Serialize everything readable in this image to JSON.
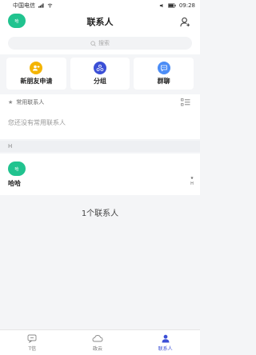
{
  "status_bar": {
    "carrier": "中国电信",
    "time": "09:28"
  },
  "header": {
    "avatar_text": "哈",
    "title": "联系人"
  },
  "search": {
    "placeholder": "搜索"
  },
  "quick_actions": [
    {
      "label": "新朋友申请",
      "color": "#f4b400",
      "icon": "new-friend-icon"
    },
    {
      "label": "分组",
      "color": "#3b4fd6",
      "icon": "group-icon"
    },
    {
      "label": "群聊",
      "color": "#4c8df6",
      "icon": "group-chat-icon"
    }
  ],
  "favorites": {
    "label": "常用联系人",
    "empty_text": "您还没有常用联系人"
  },
  "section_letter": "H",
  "contacts": [
    {
      "name": "哈哈",
      "avatar_text": "哈"
    }
  ],
  "index": [
    "★",
    "H"
  ],
  "contact_count": "1个联系人",
  "bottom_nav": [
    {
      "label": "T信",
      "icon": "chat-icon",
      "active": false
    },
    {
      "label": "政云",
      "icon": "cloud-icon",
      "active": false
    },
    {
      "label": "联系人",
      "icon": "contacts-icon",
      "active": true
    }
  ],
  "colors": {
    "accent_green": "#21c38f",
    "nav_active": "#3b4fd6"
  }
}
